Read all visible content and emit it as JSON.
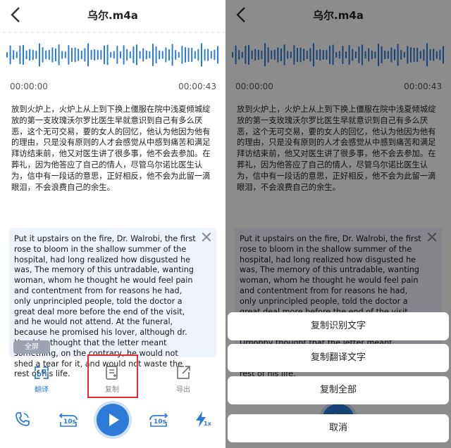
{
  "header": {
    "title": "乌尔.m4a"
  },
  "player": {
    "time_start": "00:00:00",
    "time_end": "00:00:43"
  },
  "transcript": "放到火炉上，火炉上从上到下换上僵服在院中浅夏倾城绽放的第一支玫瑰沃尔罗比医生早就意识到自己有多么厌恶，这个无可交易，要的女人的回忆，他认为他因为他有的理由，只是没有原则的人才会感觉从中感到痛苦和满足拜访结束前，他又对医生讲了很多事，他不会去参加。在葬礼，因为他答应了自己的情人，尽管乌尔诺比医生认为，信中有一段话的意思，正好相反，他不会为此留一滴眼泪，不会浪费自己的余生。",
  "translation": {
    "text": "Put it upstairs on the fire, Dr. Walrobi, the first rose to bloom in the shallow summer of the hospital, had long realized how disgusted he was, The memory of this untradable, wanting woman, whom he thought he would feel pain and contentment from for reasons he had, only unprincipled people, told the doctor a great deal more before the end of the visit, and he would not attend. At the funeral, because he promised his lover, although dr. Urnobby thought that the letter meant something, on the contrary, he would not shed a tear for it, and would not waste the rest of his life.",
    "fullscreen_label": "全屏"
  },
  "toolbar": {
    "translate_label": "翻译",
    "copy_label": "复制",
    "export_label": "导出"
  },
  "skip": {
    "back_label": "10s",
    "fwd_label": "10s"
  },
  "speed": {
    "label": "1x"
  },
  "sheet": {
    "copy_recognized": "复制识别文字",
    "copy_translation": "复制翻译文字",
    "copy_all": "复制全部",
    "cancel": "取消"
  },
  "colors": {
    "accent": "#2b7bd9",
    "highlight": "#e03030",
    "card_bg": "#eef2fb"
  }
}
